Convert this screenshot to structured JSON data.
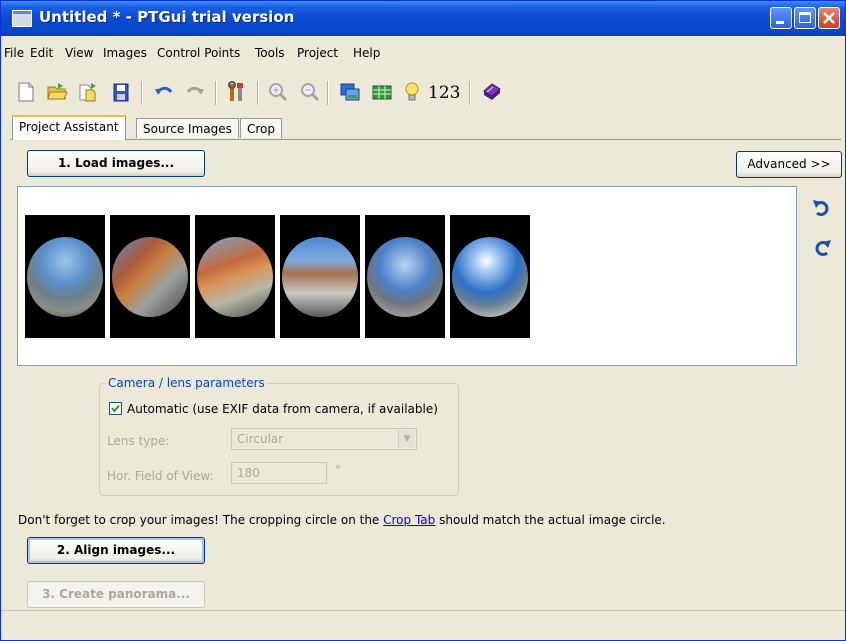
{
  "window": {
    "title": "Untitled * - PTGui trial version",
    "controls": {
      "minimize": "minimize-icon",
      "maximize": "maximize-icon",
      "close": "close-icon"
    }
  },
  "menu": [
    {
      "label": "File"
    },
    {
      "label": "Edit"
    },
    {
      "label": "View"
    },
    {
      "label": "Images"
    },
    {
      "label": "Control Points"
    },
    {
      "label": "Tools"
    },
    {
      "label": "Project"
    },
    {
      "label": "Help"
    }
  ],
  "toolbar": {
    "icons": [
      "new-document-icon",
      "open-folder-icon",
      "open-recent-icon",
      "save-icon",
      "undo-icon",
      "redo-icon",
      "tools-icon",
      "zoom-in-icon",
      "zoom-out-icon",
      "panorama-editor-icon",
      "table-icon",
      "lightbulb-icon",
      "numbers-icon",
      "batch-stitcher-icon"
    ],
    "numbers_label": "123"
  },
  "tabs": [
    {
      "label": "Project Assistant",
      "active": true
    },
    {
      "label": "Source Images",
      "active": false
    },
    {
      "label": "Crop",
      "active": false
    }
  ],
  "assistant": {
    "load_button": "1. Load images...",
    "advanced_button": "Advanced >>",
    "images": [
      "fisheye-image-1",
      "fisheye-image-2",
      "fisheye-image-3",
      "fisheye-image-4",
      "fisheye-image-5",
      "fisheye-image-6"
    ],
    "rotate_icons": [
      "rotate-left-icon",
      "rotate-right-icon"
    ],
    "camera": {
      "group_title": "Camera / lens parameters",
      "automatic_label": "Automatic (use EXIF data from camera, if available)",
      "automatic_checked": true,
      "lens_type_label": "Lens type:",
      "lens_type_value": "Circular",
      "hfov_label": "Hor. Field of View:",
      "hfov_value": "180",
      "hfov_unit": "°"
    },
    "crop_note_before": "Don't forget to crop your images! The cropping circle on the ",
    "crop_note_link": "Crop Tab",
    "crop_note_after": " should match the actual image circle.",
    "align_button": "2. Align images...",
    "create_button": "3. Create panorama..."
  },
  "colors": {
    "title_bar": "#0a4ad3",
    "link": "#0000ff",
    "group_title": "#0046d5",
    "disabled_text": "#aca899"
  }
}
